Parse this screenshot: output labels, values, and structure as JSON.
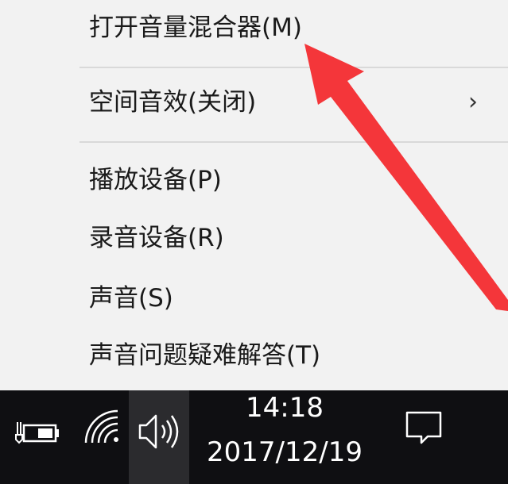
{
  "menu": {
    "items": [
      {
        "label": "打开音量混合器(M)"
      },
      {
        "label": "空间音效(关闭)",
        "submenu_glyph": "›"
      },
      {
        "label": "播放设备(P)"
      },
      {
        "label": "录音设备(R)"
      },
      {
        "label": "声音(S)"
      },
      {
        "label": "声音问题疑难解答(T)"
      }
    ]
  },
  "taskbar": {
    "time": "14:18",
    "date": "2017/12/19",
    "icons": [
      "battery-icon",
      "wifi-icon",
      "volume-icon",
      "notification-icon"
    ]
  },
  "colors": {
    "menu_bg": "#f2f2f2",
    "taskbar_bg": "#0f0f12",
    "highlight_arrow": "#f4363a"
  }
}
